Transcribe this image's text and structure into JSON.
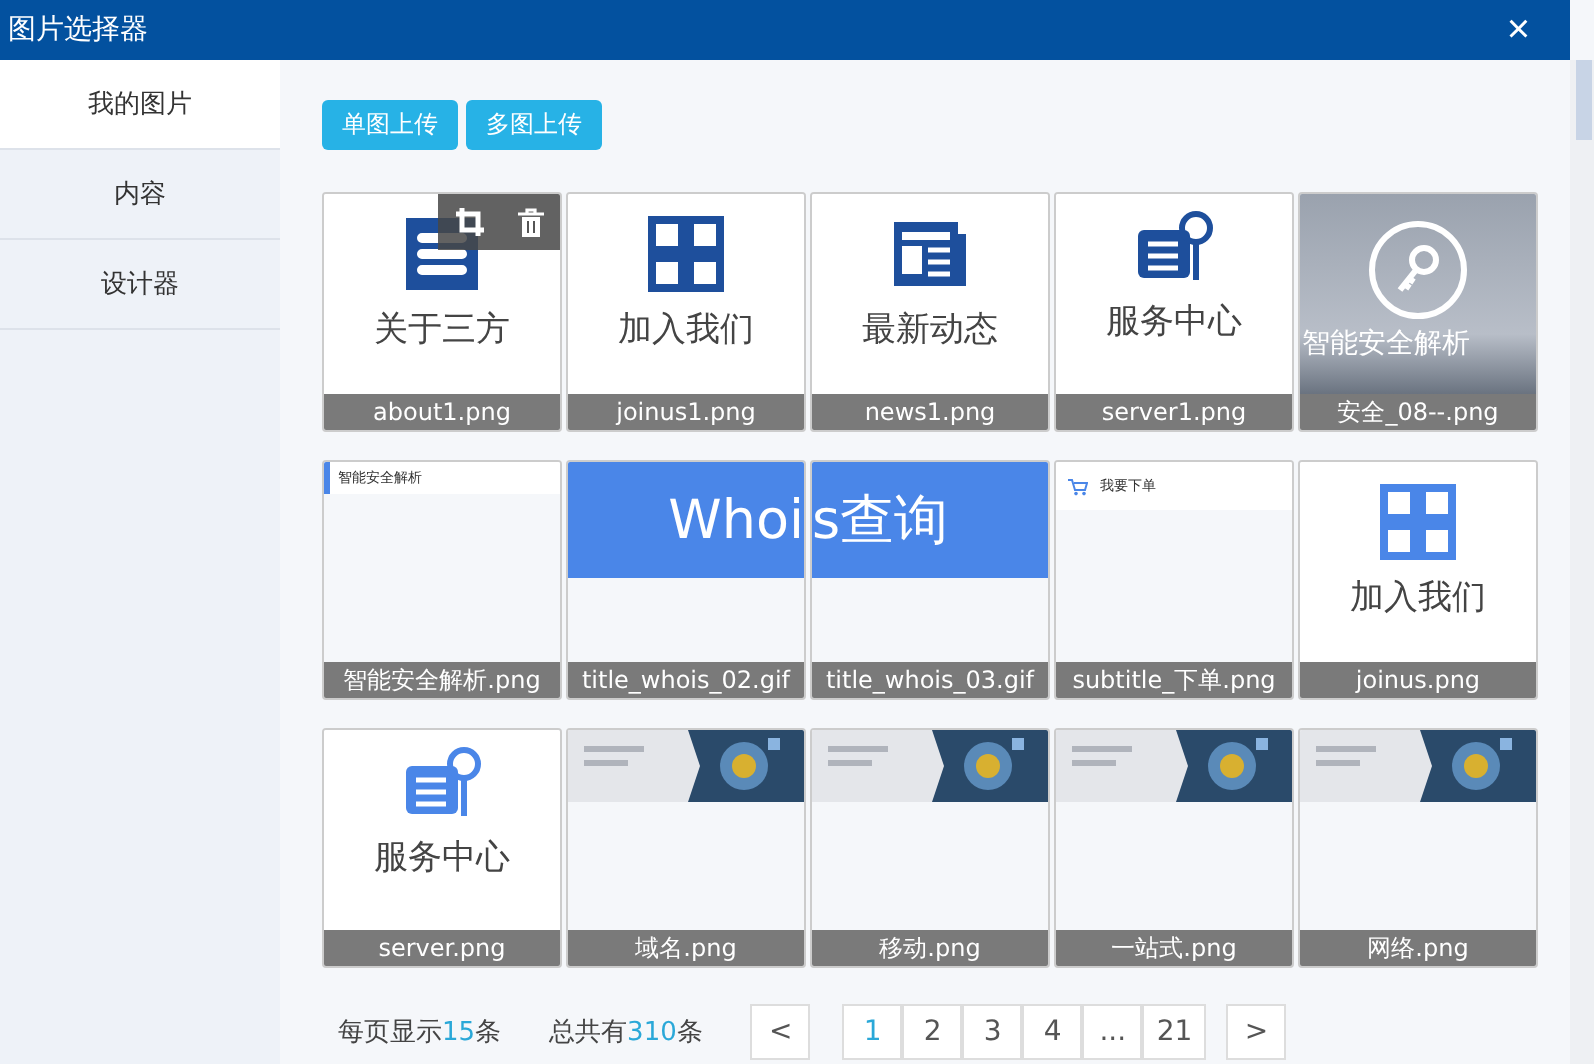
{
  "window": {
    "title": "图片选择器",
    "close": "×"
  },
  "sidebar": {
    "items": [
      {
        "label": "我的图片",
        "selected": true
      },
      {
        "label": "内容",
        "selected": false
      },
      {
        "label": "设计器",
        "selected": false
      }
    ]
  },
  "toolbar": {
    "buttons": [
      "单图上传",
      "多图上传"
    ]
  },
  "images": [
    {
      "kind": "logo",
      "label": "关于三方",
      "file": "about1.png",
      "hovered": true,
      "color": "#1e4f9c"
    },
    {
      "kind": "grid",
      "label": "加入我们",
      "file": "joinus1.png",
      "hovered": false,
      "color": "#1e4f9c"
    },
    {
      "kind": "news",
      "label": "最新动态",
      "file": "news1.png",
      "hovered": false,
      "color": "#1e4f9c"
    },
    {
      "kind": "service",
      "label": "服务中心",
      "file": "server1.png",
      "hovered": false,
      "color": "#1e4f9c"
    },
    {
      "kind": "key",
      "label": "智能安全解析",
      "file": "安全_08--.png",
      "hovered": false
    },
    {
      "kind": "heading",
      "label": "智能安全解析",
      "file": "智能安全解析.png",
      "hovered": false
    },
    {
      "kind": "bannerleft",
      "label": "Whoi",
      "file": "title_whois_02.gif",
      "hovered": false
    },
    {
      "kind": "bannerright",
      "label": "s查询",
      "file": "title_whois_03.gif",
      "hovered": false
    },
    {
      "kind": "cart",
      "label": "我要下单",
      "file": "subtitle_下单.png",
      "hovered": false
    },
    {
      "kind": "grid",
      "label": "加入我们",
      "file": "joinus.png",
      "hovered": false,
      "color": "#4a86e8"
    },
    {
      "kind": "service",
      "label": "服务中心",
      "file": "server.png",
      "hovered": false,
      "color": "#4a86e8"
    },
    {
      "kind": "picture",
      "file": "域名.png",
      "hovered": false
    },
    {
      "kind": "picture",
      "file": "移动.png",
      "hovered": false
    },
    {
      "kind": "picture",
      "file": "一站式.png",
      "hovered": false
    },
    {
      "kind": "picture",
      "file": "网络.png",
      "hovered": false
    }
  ],
  "pagination": {
    "per_page": {
      "prefix": "每页显示",
      "count": "15",
      "suffix": "条"
    },
    "total": {
      "prefix": "总共有",
      "count": "310",
      "suffix": "条"
    },
    "prev": "<",
    "next": ">",
    "pages": [
      {
        "label": "1",
        "selected": true
      },
      {
        "label": "2",
        "selected": false
      },
      {
        "label": "3",
        "selected": false
      },
      {
        "label": "4",
        "selected": false
      },
      {
        "label": "...",
        "selected": false
      },
      {
        "label": "21",
        "selected": false
      }
    ]
  }
}
